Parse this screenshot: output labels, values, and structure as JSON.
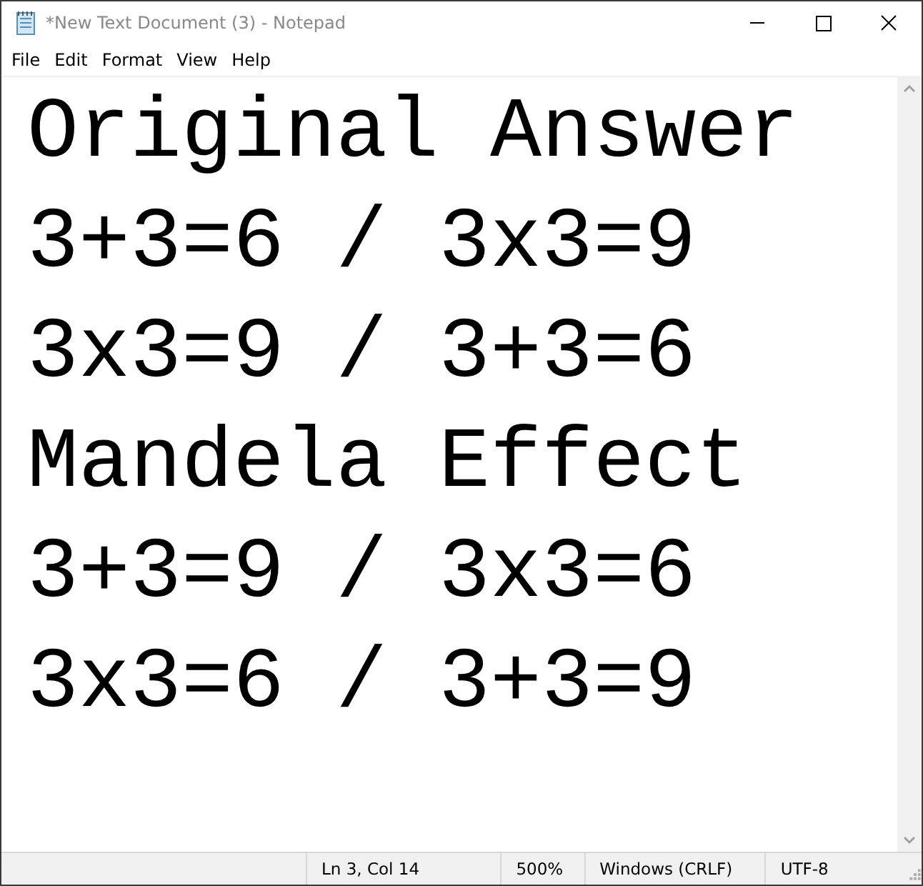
{
  "window": {
    "title": "*New Text Document (3) - Notepad"
  },
  "menu": [
    "File",
    "Edit",
    "Format",
    "View",
    "Help"
  ],
  "editor": {
    "lines": [
      "Original Answer",
      "3+3=6 / 3x3=9",
      "3x3=9 / 3+3=6",
      "Mandela Effect",
      "3+3=9 / 3x3=6",
      "3x3=6 / 3+3=9"
    ]
  },
  "status_bar": [
    "Ln 3, Col 14",
    "500%",
    "Windows (CRLF)",
    "UTF-8"
  ]
}
